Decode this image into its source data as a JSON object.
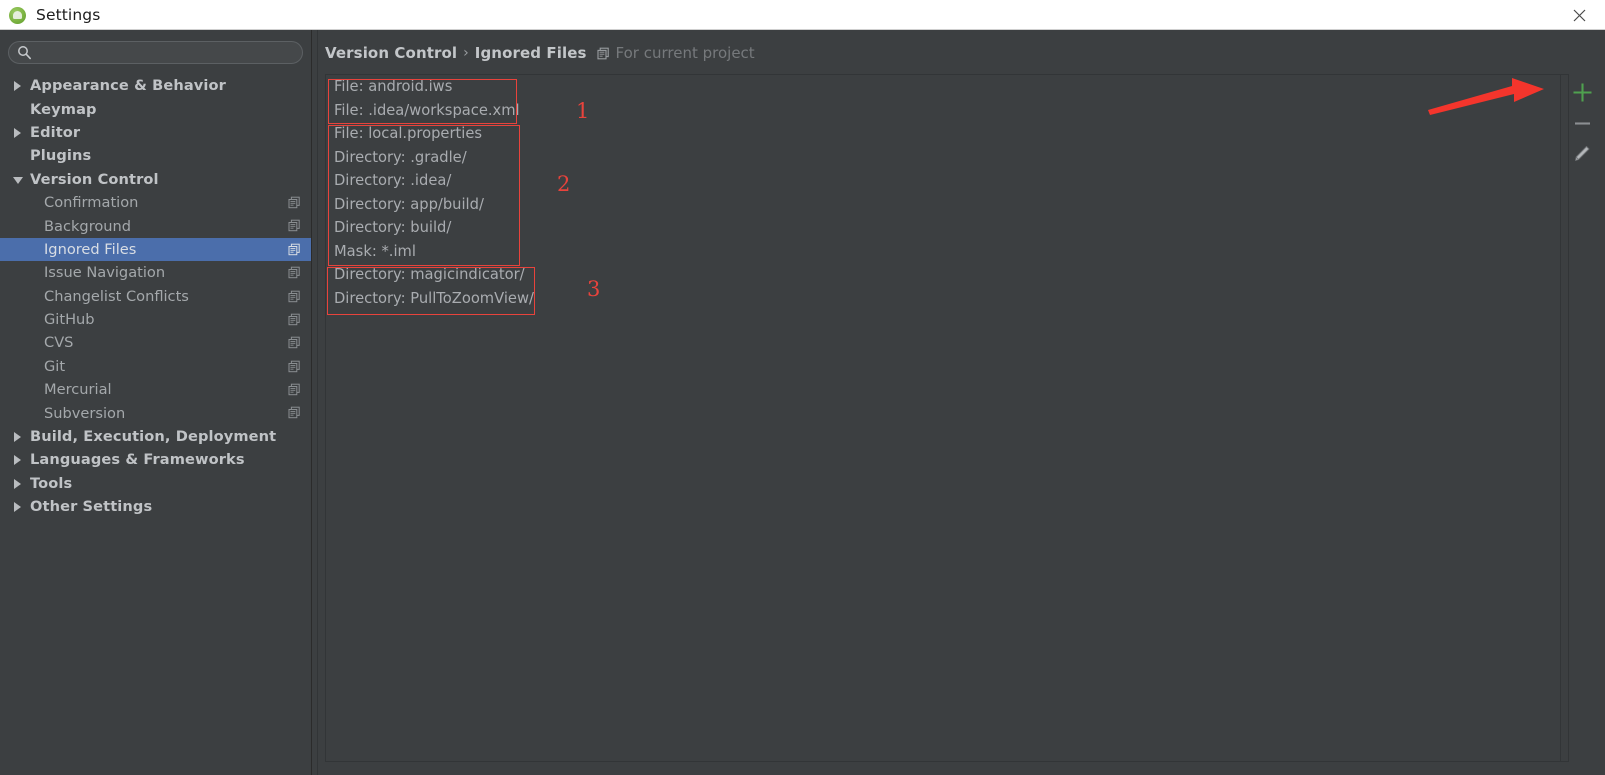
{
  "window": {
    "title": "Settings",
    "app_icon": "android-studio-icon",
    "close_icon": "close-icon"
  },
  "sidebar": {
    "search": {
      "value": "",
      "placeholder": "",
      "icon": "search-icon"
    },
    "items": [
      {
        "label": "Appearance & Behavior",
        "level": "top",
        "arrow": "right",
        "selected": false,
        "project_icon": false
      },
      {
        "label": "Keymap",
        "level": "top",
        "arrow": "none",
        "selected": false,
        "project_icon": false
      },
      {
        "label": "Editor",
        "level": "top",
        "arrow": "right",
        "selected": false,
        "project_icon": false
      },
      {
        "label": "Plugins",
        "level": "top",
        "arrow": "none",
        "selected": false,
        "project_icon": false
      },
      {
        "label": "Version Control",
        "level": "top",
        "arrow": "down",
        "selected": false,
        "project_icon": false
      },
      {
        "label": "Confirmation",
        "level": "child",
        "arrow": "none",
        "selected": false,
        "project_icon": true
      },
      {
        "label": "Background",
        "level": "child",
        "arrow": "none",
        "selected": false,
        "project_icon": true
      },
      {
        "label": "Ignored Files",
        "level": "child",
        "arrow": "none",
        "selected": true,
        "project_icon": true
      },
      {
        "label": "Issue Navigation",
        "level": "child",
        "arrow": "none",
        "selected": false,
        "project_icon": true
      },
      {
        "label": "Changelist Conflicts",
        "level": "child",
        "arrow": "none",
        "selected": false,
        "project_icon": true
      },
      {
        "label": "GitHub",
        "level": "child",
        "arrow": "none",
        "selected": false,
        "project_icon": true
      },
      {
        "label": "CVS",
        "level": "child",
        "arrow": "none",
        "selected": false,
        "project_icon": true
      },
      {
        "label": "Git",
        "level": "child",
        "arrow": "none",
        "selected": false,
        "project_icon": true
      },
      {
        "label": "Mercurial",
        "level": "child",
        "arrow": "none",
        "selected": false,
        "project_icon": true
      },
      {
        "label": "Subversion",
        "level": "child",
        "arrow": "none",
        "selected": false,
        "project_icon": true
      },
      {
        "label": "Build, Execution, Deployment",
        "level": "top",
        "arrow": "right",
        "selected": false,
        "project_icon": false
      },
      {
        "label": "Languages & Frameworks",
        "level": "top",
        "arrow": "right",
        "selected": false,
        "project_icon": false
      },
      {
        "label": "Tools",
        "level": "top",
        "arrow": "right",
        "selected": false,
        "project_icon": false
      },
      {
        "label": "Other Settings",
        "level": "top",
        "arrow": "right",
        "selected": false,
        "project_icon": false
      }
    ]
  },
  "content": {
    "breadcrumb": {
      "parent": "Version Control",
      "separator": "›",
      "current": "Ignored Files",
      "scope_icon": "project-scope-icon",
      "scope_note": "For current project"
    },
    "ignored_files": [
      "File: android.iws",
      "File: .idea/workspace.xml",
      "File: local.properties",
      "Directory: .gradle/",
      "Directory: .idea/",
      "Directory: app/build/",
      "Directory: build/",
      "Mask: *.iml",
      "Directory: magicindicator/",
      "Directory: PullToZoomView/"
    ],
    "toolbar": [
      {
        "name": "add-button",
        "icon": "plus-icon",
        "color": "#4c9e4c"
      },
      {
        "name": "remove-button",
        "icon": "minus-icon",
        "color": "#8b8f92"
      },
      {
        "name": "edit-button",
        "icon": "pencil-icon",
        "color": "#b9bcbf"
      }
    ]
  },
  "annotations": {
    "color": "#e8433c",
    "labels": [
      "1",
      "2",
      "3"
    ],
    "arrow": "red-arrow-pointing-to-add-button"
  }
}
